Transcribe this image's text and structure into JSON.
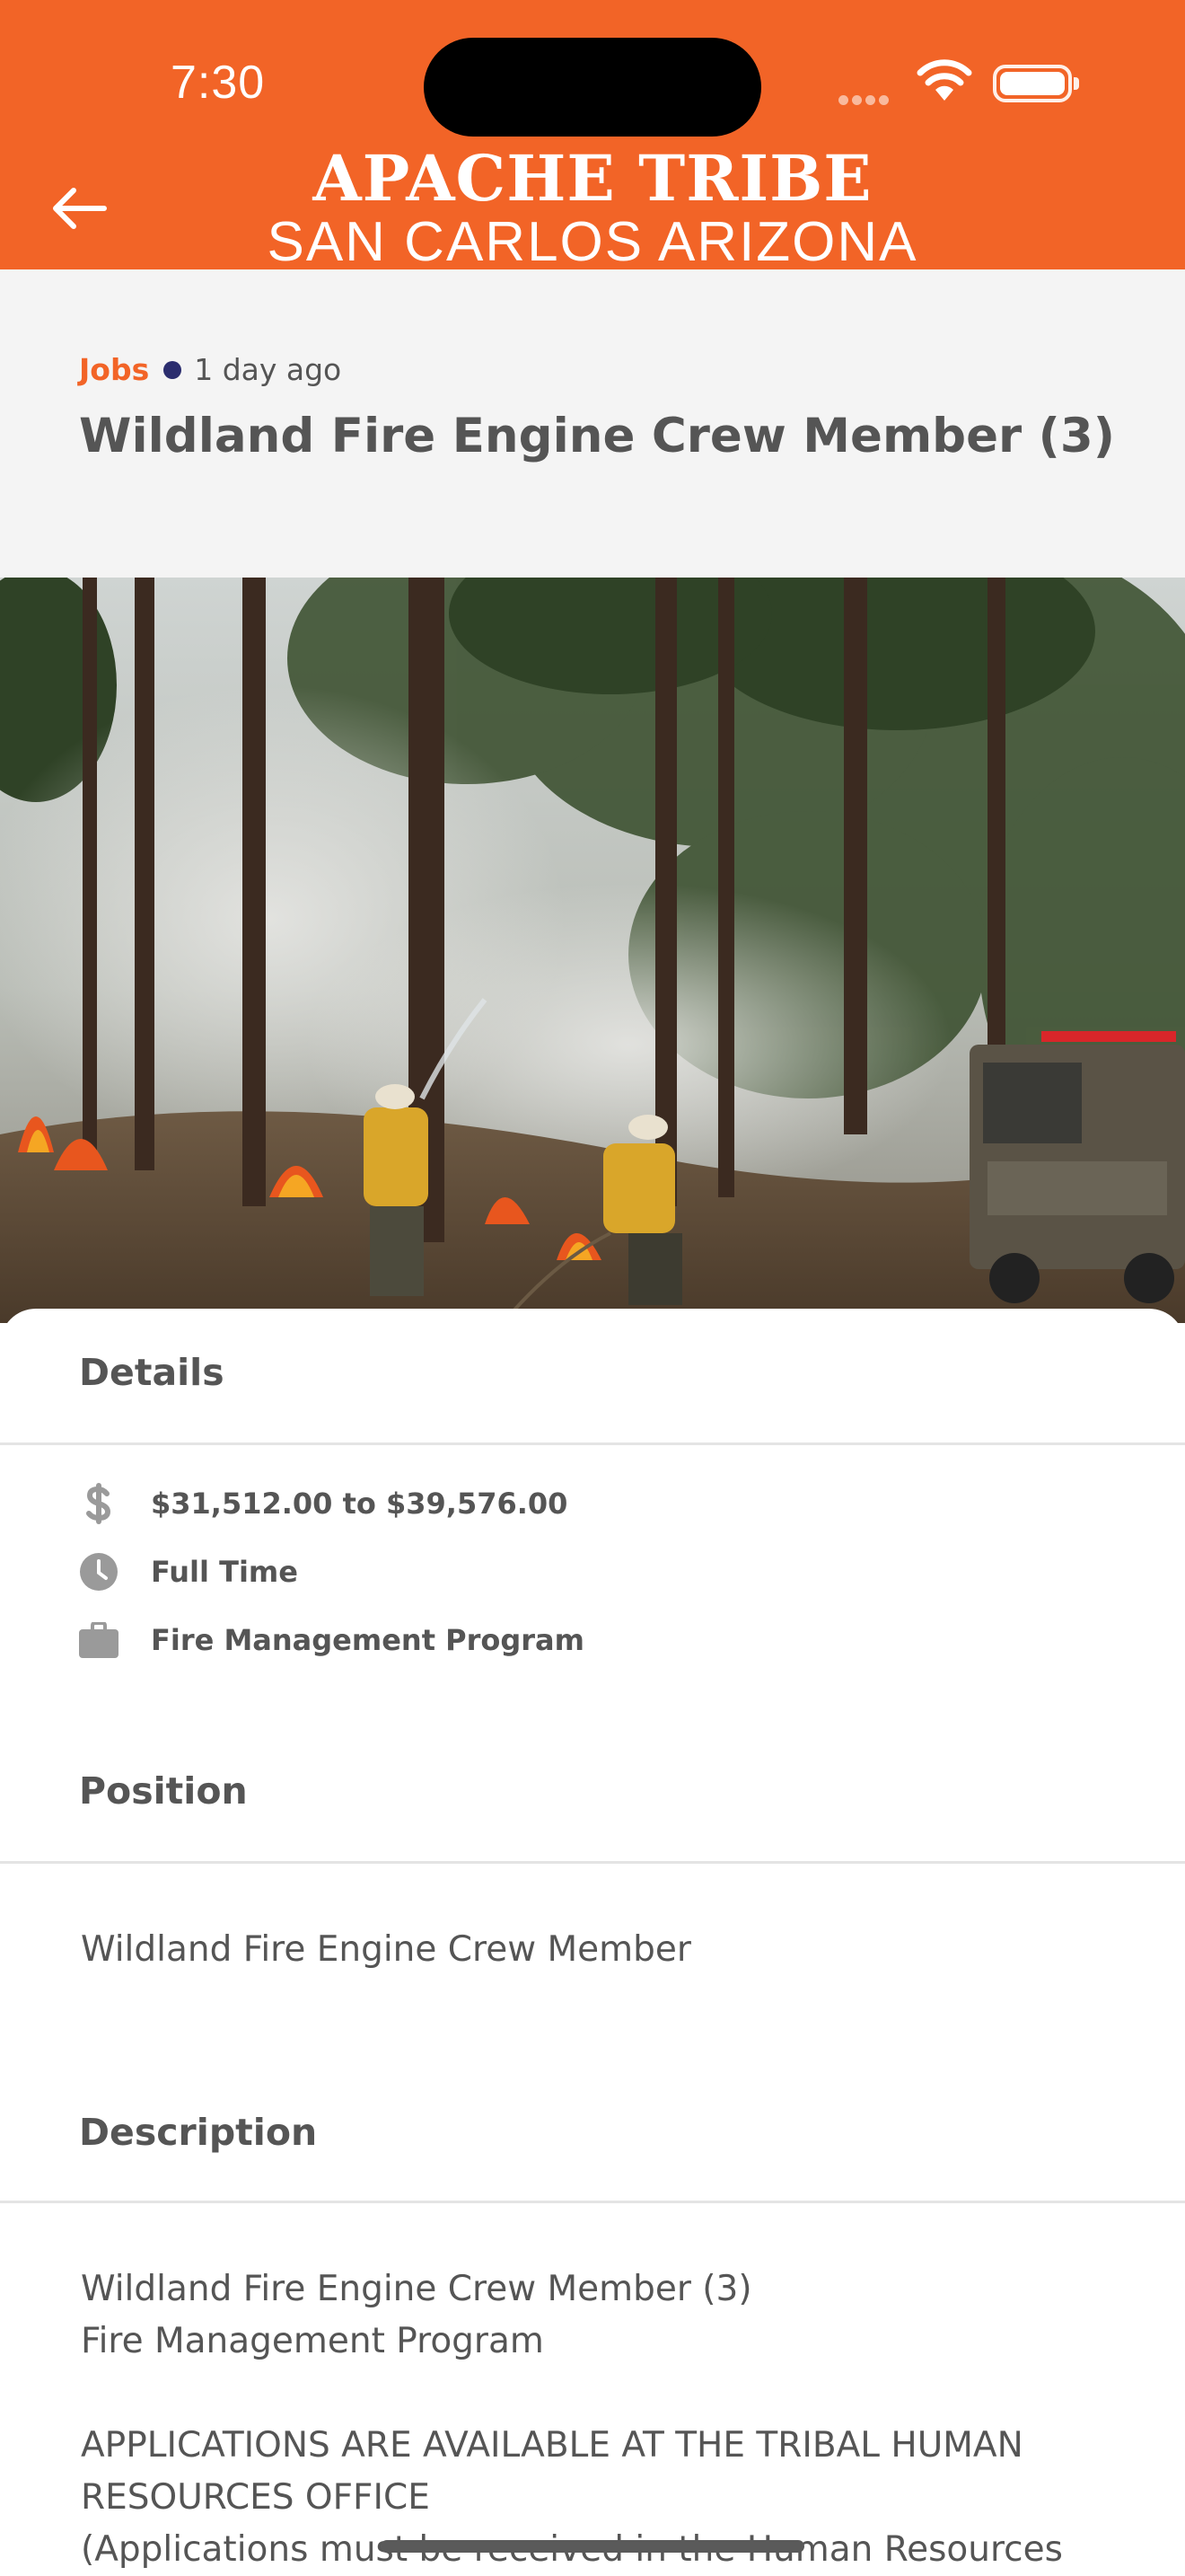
{
  "status_bar": {
    "time": "7:30"
  },
  "header": {
    "logo_line1": "APACHE TRIBE",
    "logo_line2": "SAN CARLOS ARIZONA",
    "back_icon": "arrow-left-icon",
    "brand_color": "#F26427"
  },
  "post": {
    "category": "Jobs",
    "posted": "1 day ago",
    "title": "Wildland Fire Engine Crew Member (3)"
  },
  "details": {
    "heading": "Details",
    "salary": "$31,512.00 to $39,576.00",
    "schedule": "Full Time",
    "department": "Fire Management Program",
    "icons": [
      "dollar-icon",
      "clock-icon",
      "briefcase-icon"
    ]
  },
  "position": {
    "heading": "Position",
    "text": "Wildland Fire Engine Crew Member"
  },
  "description": {
    "heading": "Description",
    "line1": "Wildland Fire Engine Crew Member (3)",
    "line2": "Fire Management Program",
    "line3": "APPLICATIONS ARE AVAILABLE AT THE TRIBAL HUMAN",
    "line4": "RESOURCES OFFICE",
    "line5": "(Applications must be received in the Human Resources"
  }
}
